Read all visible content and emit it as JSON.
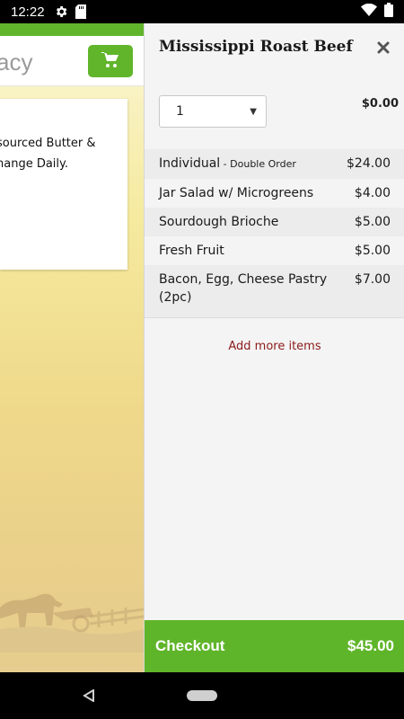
{
  "status_bar": {
    "time": "12:22",
    "icons": [
      "gear-icon",
      "sd-card-icon",
      "wifi-icon",
      "battery-icon"
    ]
  },
  "background_page": {
    "brand_fragment": "acy",
    "card_text": "sourced Butter &\nhange Daily.",
    "cart_icon": "cart-icon",
    "accent_color": "#61b52b"
  },
  "drawer": {
    "title": "Mississippi Roast Beef",
    "close_icon": "close-icon",
    "quantity": "1",
    "unit_price": "$0.00",
    "items": [
      {
        "name": "Individual",
        "sub": " - Double Order",
        "price": "$24.00"
      },
      {
        "name": "Jar Salad w/ Microgreens",
        "sub": "",
        "price": "$4.00"
      },
      {
        "name": "Sourdough Brioche",
        "sub": "",
        "price": "$5.00"
      },
      {
        "name": "Fresh Fruit",
        "sub": "",
        "price": "$5.00"
      },
      {
        "name": "Bacon, Egg, Cheese Pastry (2pc)",
        "sub": "",
        "price": "$7.00"
      }
    ],
    "add_more": "Add more items",
    "checkout_label": "Checkout",
    "checkout_total": "$45.00",
    "checkout_color": "#5fb52a",
    "link_color": "#8b1a1a"
  },
  "nav_bar": {
    "icons": [
      "back-icon",
      "home-icon"
    ]
  }
}
